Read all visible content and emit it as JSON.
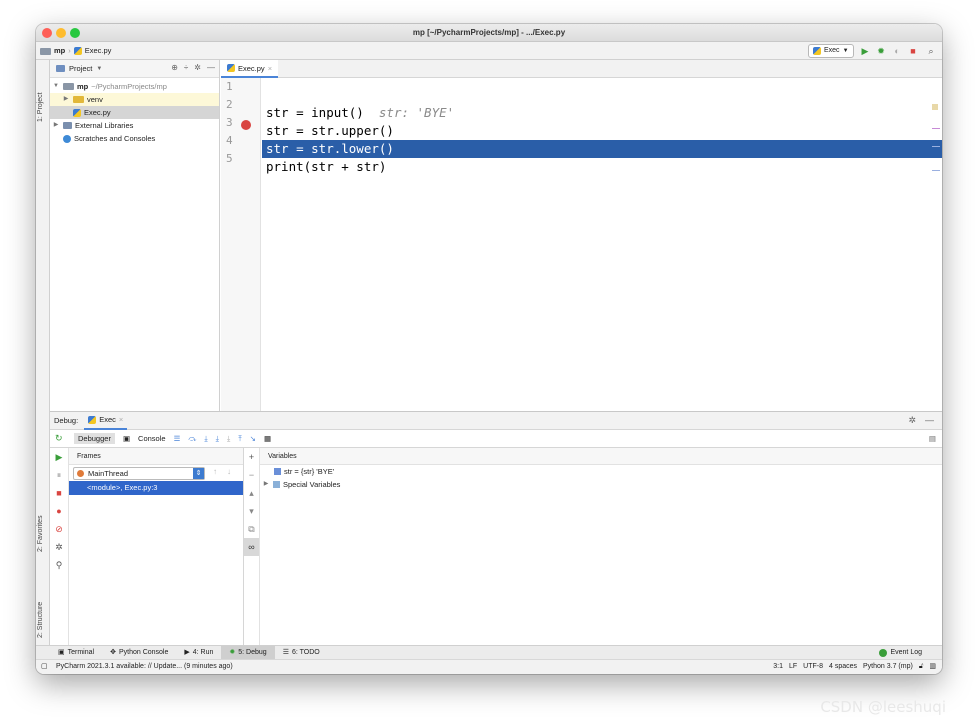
{
  "window": {
    "title": "mp [~/PycharmProjects/mp] - .../Exec.py"
  },
  "navbar": {
    "project": "mp",
    "file": "Exec.py",
    "run_config": "Exec"
  },
  "side_tabs": {
    "project": "1: Project",
    "favorites": "2: Favorites",
    "structure": "2: Structure"
  },
  "project_panel": {
    "header": "Project",
    "root_name": "mp",
    "root_path": "~/PycharmProjects/mp",
    "items": [
      {
        "label": "venv"
      },
      {
        "label": "Exec.py"
      },
      {
        "label": "External Libraries"
      },
      {
        "label": "Scratches and Consoles"
      }
    ]
  },
  "editor": {
    "tab": "Exec.py",
    "line_numbers": [
      "1",
      "2",
      "3",
      "4",
      "5"
    ],
    "lines": [
      {
        "code": "str = input()",
        "hint": "str: 'BYE'"
      },
      {
        "code": "str = str.upper()"
      },
      {
        "code": "str = str.lower()"
      },
      {
        "code": "print(str + str)"
      },
      {
        "code": ""
      }
    ],
    "current_line": 3,
    "breakpoint_line": 3
  },
  "debug": {
    "label": "Debug:",
    "session_tab": "Exec",
    "tabs": [
      "Debugger",
      "Console"
    ],
    "frames_header": "Frames",
    "variables_header": "Variables",
    "thread": "MainThread",
    "frame": "<module>, Exec.py:3",
    "variables": [
      {
        "text": "str = {str} 'BYE'"
      },
      {
        "text": "Special Variables"
      }
    ]
  },
  "tool_windows": [
    {
      "label": "Terminal"
    },
    {
      "label": "Python Console"
    },
    {
      "label": "4: Run"
    },
    {
      "label": "5: Debug"
    },
    {
      "label": "6: TODO"
    }
  ],
  "event_log": "Event Log",
  "status_bar": {
    "message": "PyCharm 2021.3.1 available: // Update... (9 minutes ago)",
    "position": "3:1",
    "line_sep": "LF",
    "encoding": "UTF-8",
    "indent": "4 spaces",
    "interpreter": "Python 3.7 (mp)"
  },
  "watermark": "CSDN @leeshuqi",
  "colors": {
    "current_line": "#2a5ea8",
    "breakpoint": "#d94541",
    "selected_frame": "#2f65ca",
    "run_green": "#3a9e3a",
    "stop_red": "#d94541"
  }
}
